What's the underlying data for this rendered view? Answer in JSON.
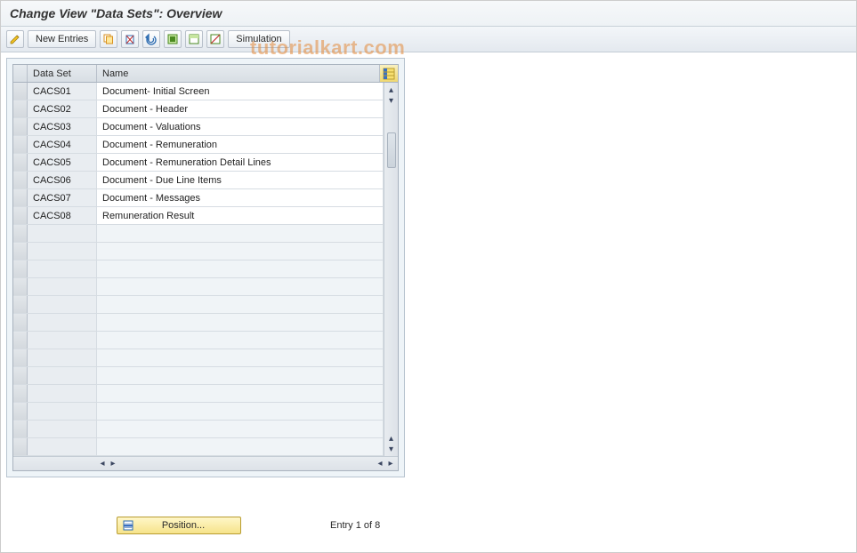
{
  "header": {
    "title": "Change View \"Data Sets\": Overview"
  },
  "toolbar": {
    "new_entries_label": "New Entries",
    "simulation_label": "Simulation"
  },
  "watermark": "tutorialkart.com",
  "table": {
    "columns": {
      "data_set": "Data Set",
      "name": "Name"
    },
    "rows": [
      {
        "data_set": "CACS01",
        "name": "Document- Initial Screen"
      },
      {
        "data_set": "CACS02",
        "name": "Document - Header"
      },
      {
        "data_set": "CACS03",
        "name": "Document - Valuations"
      },
      {
        "data_set": "CACS04",
        "name": "Document - Remuneration"
      },
      {
        "data_set": "CACS05",
        "name": "Document - Remuneration Detail Lines"
      },
      {
        "data_set": "CACS06",
        "name": "Document - Due Line Items"
      },
      {
        "data_set": "CACS07",
        "name": "Document - Messages"
      },
      {
        "data_set": "CACS08",
        "name": "Remuneration Result"
      }
    ],
    "empty_rows": 13
  },
  "footer": {
    "position_label": "Position...",
    "entry_text": "Entry 1 of 8"
  }
}
